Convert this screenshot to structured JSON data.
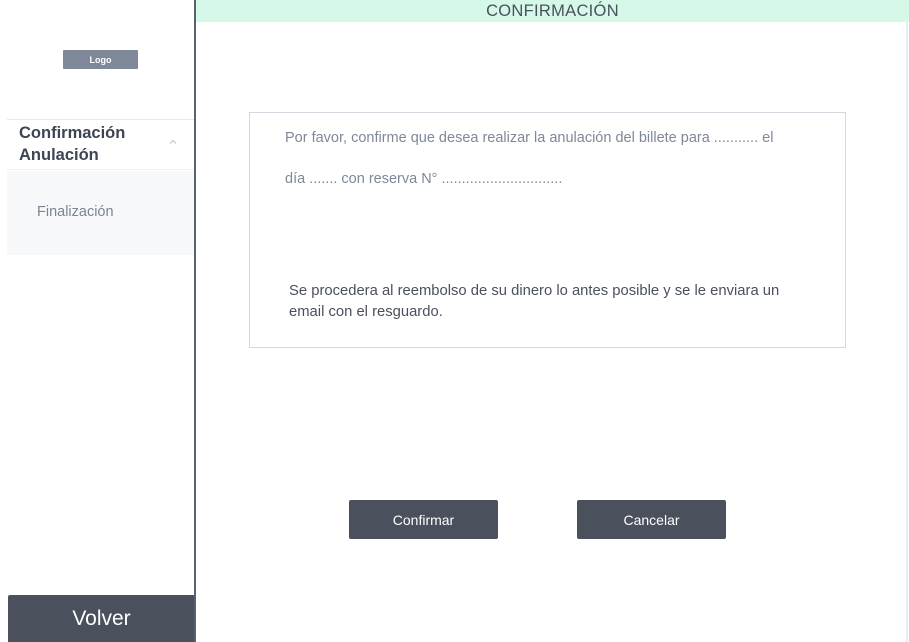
{
  "header": {
    "title": "CONFIRMACIÓN"
  },
  "sidebar": {
    "logo_label": "Logo",
    "section_title": "Confirmación Anulación",
    "items": [
      {
        "label": "Finalización"
      }
    ],
    "back_label": "Volver"
  },
  "message": {
    "line1": "Por favor, confirme que desea realizar la anulación del billete para ........... el",
    "line2": "día ....... con reserva N° ..............................",
    "refund": "Se procedera al reembolso de su dinero lo antes posible y se le enviara un email con el resguardo."
  },
  "actions": {
    "confirm_label": "Confirmar",
    "cancel_label": "Cancelar"
  },
  "colors": {
    "header_bg": "#d5f8e8",
    "button_bg": "#4a505c",
    "sidebar_border": "#5a6170"
  },
  "icons": {
    "section_toggle": "chevron-up-icon"
  }
}
